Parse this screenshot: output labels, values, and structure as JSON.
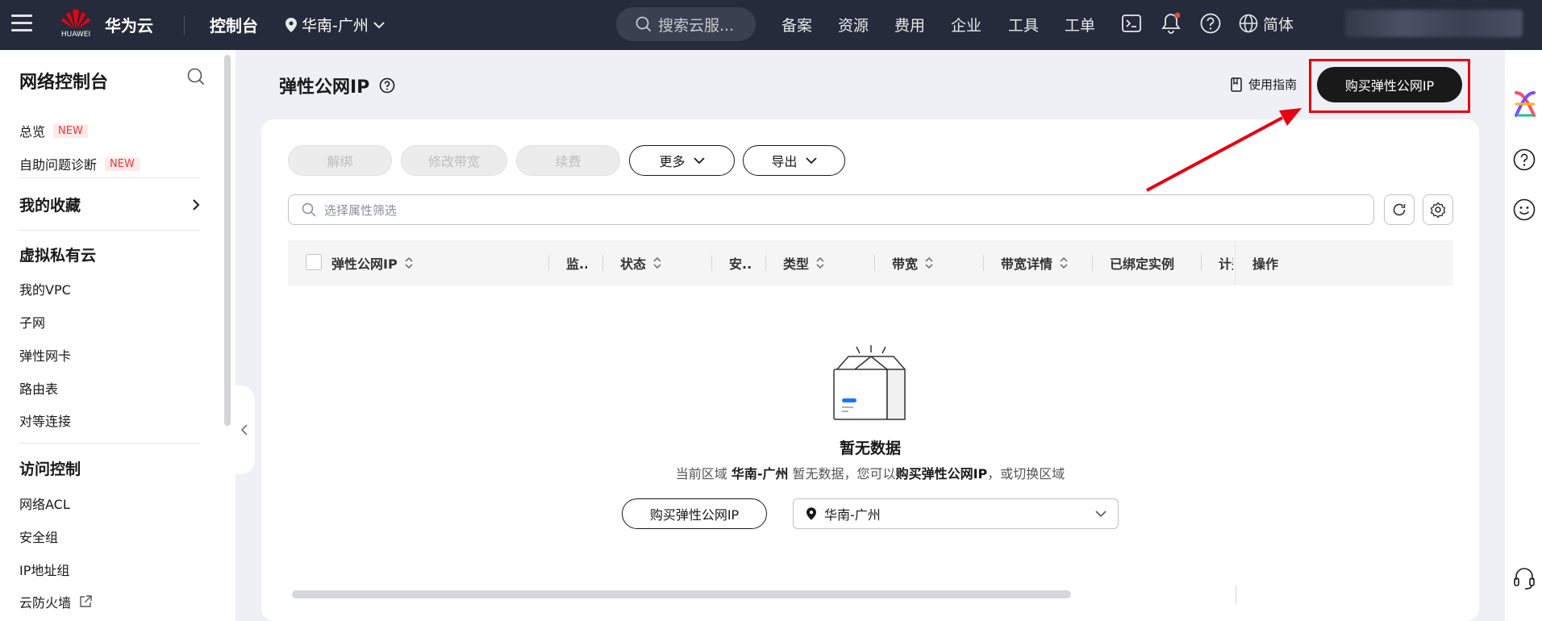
{
  "header": {
    "logo_text": "HUAWEI",
    "brand": "华为云",
    "console": "控制台",
    "region": "华南-广州",
    "search_placeholder": "搜索云服...",
    "nav": [
      "备案",
      "资源",
      "费用",
      "企业",
      "工具",
      "工单"
    ],
    "language": "简体"
  },
  "sidebar": {
    "title": "网络控制台",
    "overview": "总览",
    "overview_badge": "NEW",
    "diagnose": "自助问题诊断",
    "diagnose_badge": "NEW",
    "favorites": "我的收藏",
    "group_vpc": "虚拟私有云",
    "items_vpc": [
      "我的VPC",
      "子网",
      "弹性网卡",
      "路由表",
      "对等连接"
    ],
    "group_access": "访问控制",
    "items_access": [
      "网络ACL",
      "安全组",
      "IP地址组",
      "云防火墙"
    ]
  },
  "main": {
    "title": "弹性公网IP",
    "guide": "使用指南",
    "buy_button": "购买弹性公网IP",
    "toolbar": {
      "unbind": "解绑",
      "modify_bandwidth": "修改带宽",
      "renew": "续费",
      "more": "更多",
      "export": "导出"
    },
    "filter_placeholder": "选择属性筛选",
    "columns": [
      "弹性公网IP",
      "监...",
      "状态",
      "安...",
      "类型",
      "带宽",
      "带宽详情",
      "已绑定实例",
      "计费",
      "操作"
    ],
    "empty": {
      "title": "暂无数据",
      "desc_prefix": "当前区域 ",
      "desc_region": "华南-广州",
      "desc_middle": " 暂无数据，您可以",
      "desc_link": "购买弹性公网IP",
      "desc_suffix": "，或切换区域",
      "buy_button": "购买弹性公网IP",
      "region_select": "华南-广州"
    }
  },
  "colors": {
    "topbar": "#252b3a",
    "highlight": "#e60012",
    "primary_button": "#191919",
    "badge": "#e63c3c"
  }
}
